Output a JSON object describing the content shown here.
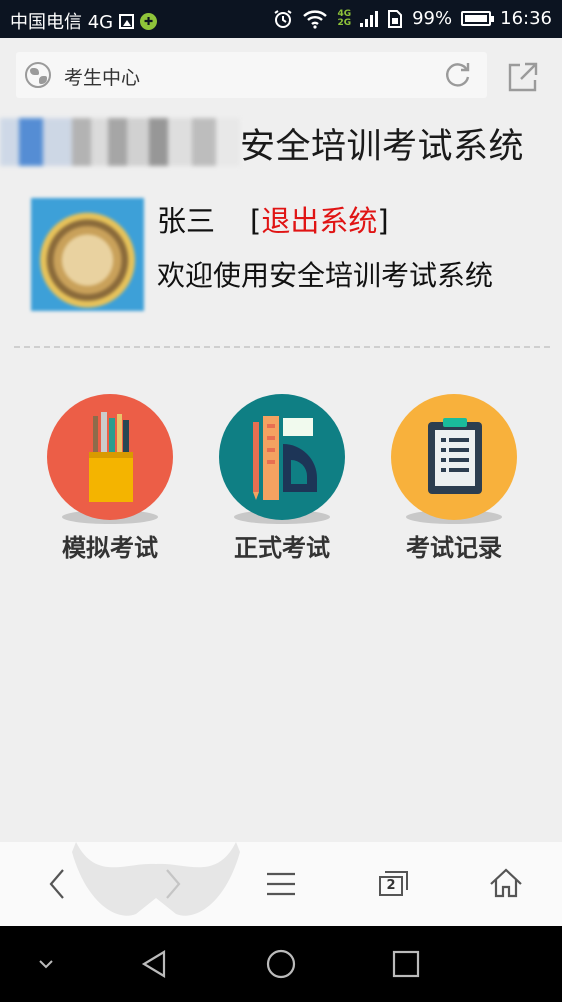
{
  "status_bar": {
    "carrier": "中国电信 4G",
    "network_small": [
      "4G",
      "2G"
    ],
    "battery": "99%",
    "time": "16:36"
  },
  "browser": {
    "page_title": "考生中心",
    "tab_count": "2"
  },
  "header": {
    "system_title": "安全培训考试系统"
  },
  "user": {
    "name": "张三",
    "logout_open": "[",
    "logout_label": "退出系统",
    "logout_close": "]",
    "welcome": "欢迎使用安全培训考试系统"
  },
  "menu": [
    {
      "label": "模拟考试",
      "icon": "pencil-cup-icon",
      "color": "#ec5e47"
    },
    {
      "label": "正式考试",
      "icon": "ruler-protractor-icon",
      "color": "#0f7f84"
    },
    {
      "label": "考试记录",
      "icon": "clipboard-icon",
      "color": "#f8b13c"
    }
  ],
  "colors": {
    "logout": "#e01414",
    "status_bar": "#0c1421",
    "page_bg": "#efefef"
  }
}
